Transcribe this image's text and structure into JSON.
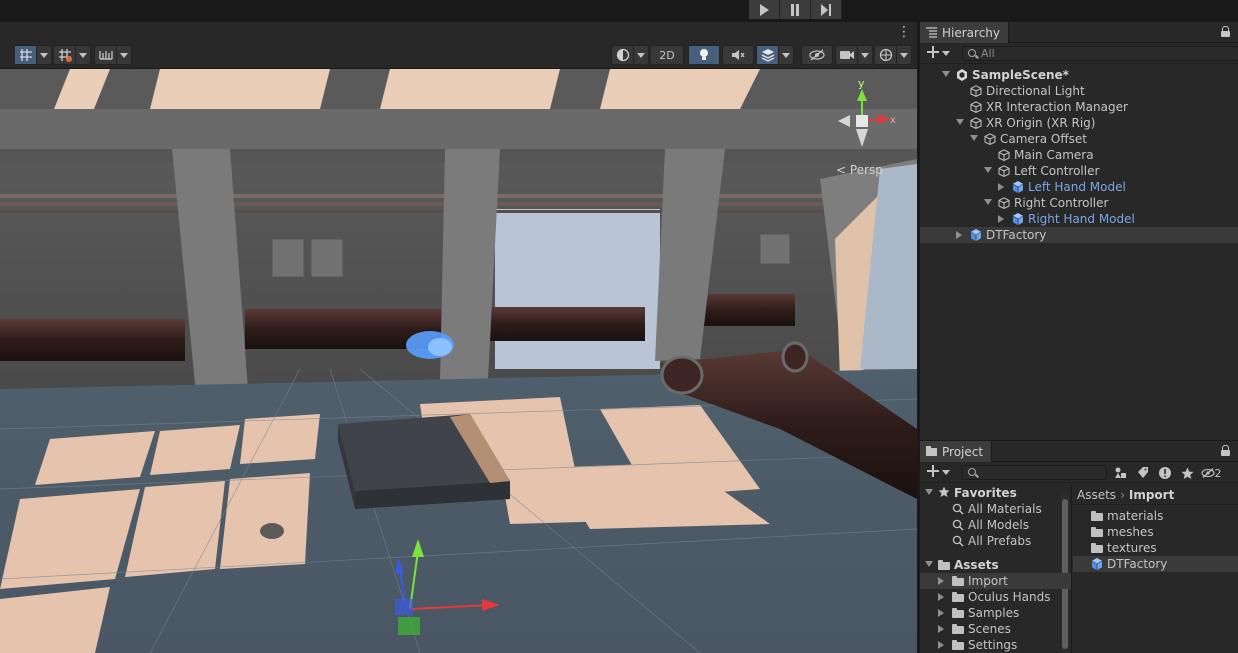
{
  "playmode": {
    "buttons": [
      {
        "name": "play",
        "icon": "play-icon"
      },
      {
        "name": "pause",
        "icon": "pause-icon"
      },
      {
        "name": "step",
        "icon": "step-icon"
      }
    ]
  },
  "scene_toolbar": {
    "toggle_2d_label": "2D",
    "persp_label": "< Persp",
    "gizmo_axis_y": "y",
    "gizmo_axis_x": "x"
  },
  "hierarchy": {
    "tab_label": "Hierarchy",
    "search_placeholder": "All",
    "items": [
      {
        "label": "SampleScene*",
        "depth": 0,
        "fold": "open",
        "icon": "unity-scene-icon",
        "style": "bold"
      },
      {
        "label": "Directional Light",
        "depth": 1,
        "fold": "none",
        "icon": "gameobject-icon",
        "style": "normal"
      },
      {
        "label": "XR Interaction Manager",
        "depth": 1,
        "fold": "none",
        "icon": "gameobject-icon",
        "style": "normal"
      },
      {
        "label": "XR Origin (XR Rig)",
        "depth": 1,
        "fold": "open",
        "icon": "gameobject-icon",
        "style": "normal"
      },
      {
        "label": "Camera Offset",
        "depth": 2,
        "fold": "open",
        "icon": "gameobject-icon",
        "style": "normal"
      },
      {
        "label": "Main Camera",
        "depth": 3,
        "fold": "none",
        "icon": "gameobject-icon",
        "style": "normal"
      },
      {
        "label": "Left Controller",
        "depth": 3,
        "fold": "open",
        "icon": "gameobject-icon",
        "style": "normal"
      },
      {
        "label": "Left Hand Model",
        "depth": 4,
        "fold": "closed",
        "icon": "prefab-icon",
        "style": "blue"
      },
      {
        "label": "Right Controller",
        "depth": 3,
        "fold": "open",
        "icon": "gameobject-icon",
        "style": "normal"
      },
      {
        "label": "Right Hand Model",
        "depth": 4,
        "fold": "closed",
        "icon": "prefab-icon",
        "style": "blue"
      },
      {
        "label": "DTFactory",
        "depth": 1,
        "fold": "closed",
        "icon": "prefab-icon",
        "style": "normal"
      }
    ]
  },
  "project": {
    "tab_label": "Project",
    "hidden_count": "2",
    "favorites": {
      "label": "Favorites",
      "items": [
        "All Materials",
        "All Models",
        "All Prefabs"
      ]
    },
    "assets": {
      "label": "Assets",
      "items": [
        {
          "label": "Import",
          "selected": true
        },
        {
          "label": "Oculus Hands",
          "selected": false
        },
        {
          "label": "Samples",
          "selected": false
        },
        {
          "label": "Scenes",
          "selected": false
        },
        {
          "label": "Settings",
          "selected": false
        }
      ]
    },
    "breadcrumb": {
      "root": "Assets",
      "current": "Import"
    },
    "contents": [
      {
        "label": "materials",
        "icon": "folder-icon"
      },
      {
        "label": "meshes",
        "icon": "folder-icon"
      },
      {
        "label": "textures",
        "icon": "folder-icon"
      },
      {
        "label": "DTFactory",
        "icon": "prefab-icon"
      }
    ]
  },
  "colors": {
    "accent_blue": "#46607c",
    "prefab_blue": "#7ba6e6",
    "panel_bg": "#282828"
  }
}
